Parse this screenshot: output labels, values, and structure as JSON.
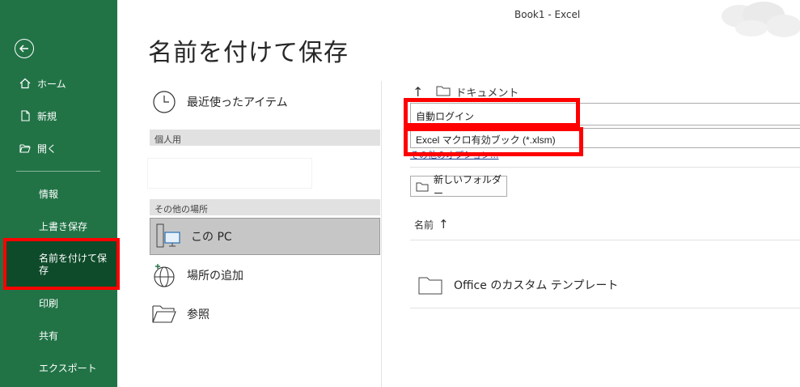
{
  "window": {
    "title": "Book1  -  Excel"
  },
  "page": {
    "title": "名前を付けて保存"
  },
  "sidebar": {
    "items": [
      {
        "label": "ホーム",
        "icon": "home-icon"
      },
      {
        "label": "新規",
        "icon": "new-file-icon"
      },
      {
        "label": "開く",
        "icon": "open-folder-icon"
      },
      {
        "label": "情報"
      },
      {
        "label": "上書き保存"
      },
      {
        "label": "名前を付けて保存",
        "selected": true
      },
      {
        "label": "印刷"
      },
      {
        "label": "共有"
      },
      {
        "label": "エクスポート"
      }
    ]
  },
  "locations": {
    "recent": "最近使ったアイテム",
    "personal_header": "個人用",
    "other_header": "その他の場所",
    "this_pc": "この PC",
    "add_place": "場所の追加",
    "browse": "参照"
  },
  "save": {
    "path": "ドキュメント",
    "filename": "自動ログイン",
    "filetype": "Excel マクロ有効ブック (*.xlsm)",
    "more_options": "その他のオプション...",
    "new_folder": "新しいフォルダー",
    "column_name": "名前",
    "sort_arrow": "↑",
    "files": [
      {
        "name": "Office のカスタム テンプレート",
        "icon": "folder-icon"
      }
    ]
  },
  "colors": {
    "sidebar": "#217346",
    "sidebar_selected": "#0e4b2a",
    "highlight": "#ff0000"
  }
}
